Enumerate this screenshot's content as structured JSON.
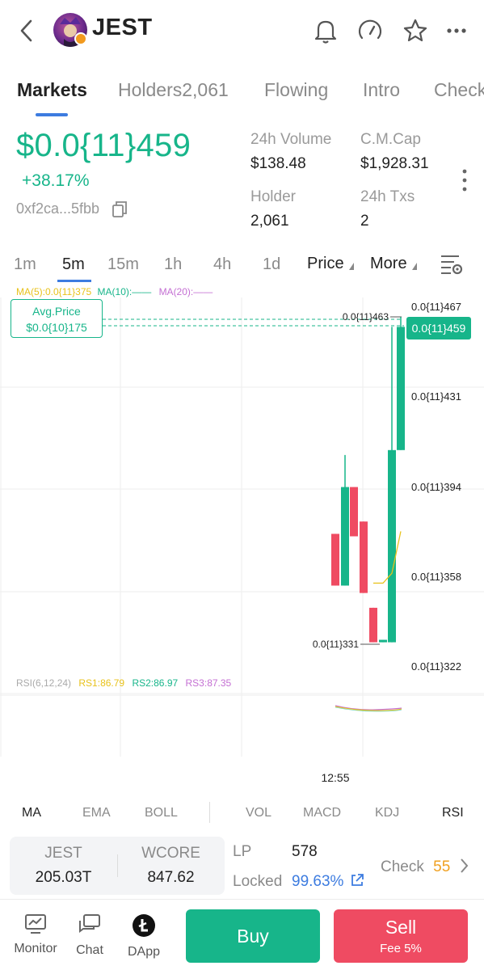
{
  "header": {
    "title": "JEST",
    "icons": [
      "back-icon",
      "bell-icon",
      "gauge-icon",
      "star-icon",
      "more-icon"
    ]
  },
  "tabs": [
    {
      "label": "Markets"
    },
    {
      "label": "Holders2,061"
    },
    {
      "label": "Flowing"
    },
    {
      "label": "Intro"
    },
    {
      "label": "Check"
    }
  ],
  "price": {
    "value": "$0.0{11}459",
    "change": "+38.17%",
    "address": "0xf2ca...5fbb"
  },
  "stats": {
    "volume_label": "24h Volume",
    "volume_value": "$138.48",
    "mcap_label": "C.M.Cap",
    "mcap_value": "$1,928.31",
    "holder_label": "Holder",
    "holder_value": "2,061",
    "txs_label": "24h Txs",
    "txs_value": "2"
  },
  "intervals": [
    "1m",
    "5m",
    "15m",
    "1h",
    "4h",
    "1d"
  ],
  "dropdowns": {
    "price": "Price",
    "more": "More"
  },
  "ma_legend": {
    "ma5": "MA(5):0.0{11}375",
    "ma10": "MA(10):——",
    "ma20": "MA(20):——"
  },
  "avg_price": {
    "label": "Avg.Price",
    "value": "$0.0{10}175"
  },
  "chart_data": {
    "type": "candlestick",
    "y_tick_labels": [
      "0.0{11}467",
      "0.0{11}431",
      "0.0{11}394",
      "0.0{11}358",
      "0.0{11}322"
    ],
    "y_tick_values": [
      467,
      431,
      394,
      358,
      322
    ],
    "current_price_label": "0.0{11}459",
    "high_label": "0.0{11}463",
    "low_label": "0.0{11}331",
    "x_tick_labels": [
      "12:55"
    ],
    "candles": [
      {
        "open": 375,
        "high": 375,
        "low": 354,
        "close": 354,
        "dir": "down"
      },
      {
        "open": 354,
        "high": 407,
        "low": 354,
        "close": 394,
        "dir": "up"
      },
      {
        "open": 394,
        "high": 394,
        "low": 374,
        "close": 374,
        "dir": "down"
      },
      {
        "open": 380,
        "high": 380,
        "low": 351,
        "close": 351,
        "dir": "down"
      },
      {
        "open": 345,
        "high": 345,
        "low": 331,
        "close": 331,
        "dir": "down"
      },
      {
        "open": 332,
        "high": 332,
        "low": 331,
        "close": 331,
        "dir": "up"
      },
      {
        "open": 331,
        "high": 459,
        "low": 331,
        "close": 409,
        "dir": "up"
      },
      {
        "open": 409,
        "high": 463,
        "low": 409,
        "close": 459,
        "dir": "up"
      }
    ],
    "ma5": [
      355,
      355,
      359,
      376
    ],
    "grid": true,
    "colors": {
      "up": "#17b58a",
      "down": "#ef4b62",
      "ma5": "#e8c21b"
    }
  },
  "rsi_legend": {
    "label": "RSI(6,12,24)",
    "rs1": "RS1:86.79",
    "rs2": "RS2:86.97",
    "rs3": "RS3:87.35"
  },
  "indicators": [
    "MA",
    "EMA",
    "BOLL",
    "VOL",
    "MACD",
    "KDJ",
    "RSI"
  ],
  "pair": {
    "base_label": "JEST",
    "base_value": "205.03T",
    "quote_label": "WCORE",
    "quote_value": "847.62"
  },
  "lp": {
    "lp_label": "LP",
    "lp_value": "578",
    "locked_label": "Locked",
    "locked_value": "99.63%",
    "check_label": "Check",
    "check_value": "55"
  },
  "bottom_nav": [
    {
      "label": "Monitor",
      "icon": "monitor-icon"
    },
    {
      "label": "Chat",
      "icon": "chat-icon"
    },
    {
      "label": "DApp",
      "icon": "dapp-icon"
    }
  ],
  "actions": {
    "buy": "Buy",
    "sell": "Sell",
    "fee": "Fee 5%"
  },
  "colors": {
    "green": "#17b58a",
    "red": "#ef4b62",
    "blue": "#3d7ce0",
    "ma5": "#e8c21b",
    "ma10": "#17b58a",
    "ma20": "#c46fd3",
    "check": "#f0a020"
  }
}
